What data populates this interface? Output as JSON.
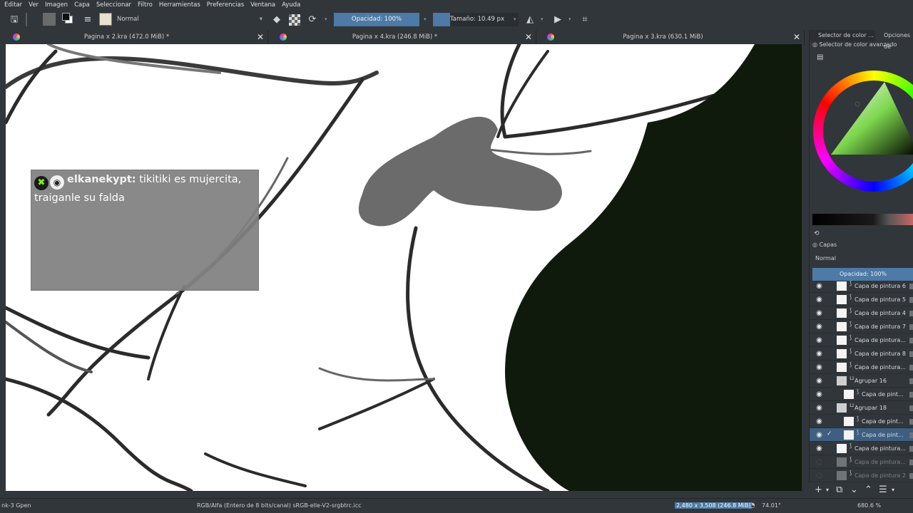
{
  "menu": [
    "Editar",
    "Ver",
    "Imagen",
    "Capa",
    "Seleccionar",
    "Filtro",
    "Herramientas",
    "Preferencias",
    "Ventana",
    "Ayuda"
  ],
  "toolbar": {
    "blend_mode": "Normal",
    "opacity_label": "Opacidad: 100%",
    "size_label": "Tamaño: 10.49 px",
    "size_fraction": 0.2
  },
  "tabs": [
    {
      "title": "Pagina x 2.kra (472.0 MiB) *"
    },
    {
      "title": "Pagina x 4.kra (246.8 MiB) *"
    },
    {
      "title": "Pagina x 3.kra (630.1 MiB)"
    }
  ],
  "chat": {
    "username": "elkanekypt:",
    "message": " tikitiki es mujercita, traiganle su falda"
  },
  "right_panel": {
    "tab_color_selector": "Selector de color ...",
    "tab_options": "Opciones de",
    "advanced_selector_label": "Selector de color avanzado",
    "layers_title": "Capas",
    "layers_blend": "Normal",
    "layers_opacity": "Opacidad:  100%"
  },
  "layers": [
    {
      "name": "Capa de pintura 6",
      "visible": true,
      "indent": 0,
      "group": false,
      "selected": false,
      "dim": false
    },
    {
      "name": "Capa de pintura 5",
      "visible": true,
      "indent": 0,
      "group": false,
      "selected": false,
      "dim": false
    },
    {
      "name": "Capa de pintura 4",
      "visible": true,
      "indent": 0,
      "group": false,
      "selected": false,
      "dim": false
    },
    {
      "name": "Capa de pintura 7",
      "visible": true,
      "indent": 0,
      "group": false,
      "selected": false,
      "dim": false
    },
    {
      "name": "Capa de pintura...",
      "visible": true,
      "indent": 0,
      "group": false,
      "selected": false,
      "dim": false
    },
    {
      "name": "Capa de pintura 8",
      "visible": true,
      "indent": 0,
      "group": false,
      "selected": false,
      "dim": false
    },
    {
      "name": "Capa de pintura...",
      "visible": true,
      "indent": 0,
      "group": false,
      "selected": false,
      "dim": false
    },
    {
      "name": "Agrupar 16",
      "visible": true,
      "indent": 0,
      "group": true,
      "selected": false,
      "dim": false
    },
    {
      "name": "Capa de pint...",
      "visible": true,
      "indent": 1,
      "group": false,
      "selected": false,
      "dim": false
    },
    {
      "name": "Agrupar 18",
      "visible": true,
      "indent": 0,
      "group": true,
      "selected": false,
      "dim": false
    },
    {
      "name": "Capa de pint...",
      "visible": true,
      "indent": 1,
      "group": false,
      "selected": false,
      "dim": false
    },
    {
      "name": "Capa de pint...",
      "visible": true,
      "indent": 1,
      "group": false,
      "selected": true,
      "dim": false
    },
    {
      "name": "Capa de pintura...",
      "visible": true,
      "indent": 0,
      "group": false,
      "selected": false,
      "dim": false
    },
    {
      "name": "Capa de pintura...",
      "visible": false,
      "indent": 0,
      "group": false,
      "selected": false,
      "dim": true
    },
    {
      "name": "Capa de pintura 2",
      "visible": false,
      "indent": 0,
      "group": false,
      "selected": false,
      "dim": true
    }
  ],
  "status": {
    "brush": "nk-3 Gpen",
    "color_space": "RGB/Alfa (Entero de 8 bits/canal)  sRGB-elle-V2-srgbtrc.icc",
    "dimensions": "2,480 x 3,508 (246.8 MiB)",
    "rotation": "74.01°",
    "zoom": "680.6 %"
  },
  "colors": {
    "accent": "#4d7aa6",
    "panel_bg": "#31363b",
    "dark_fill": "#0f1a0c",
    "gray_fill": "#6b6b6b"
  }
}
